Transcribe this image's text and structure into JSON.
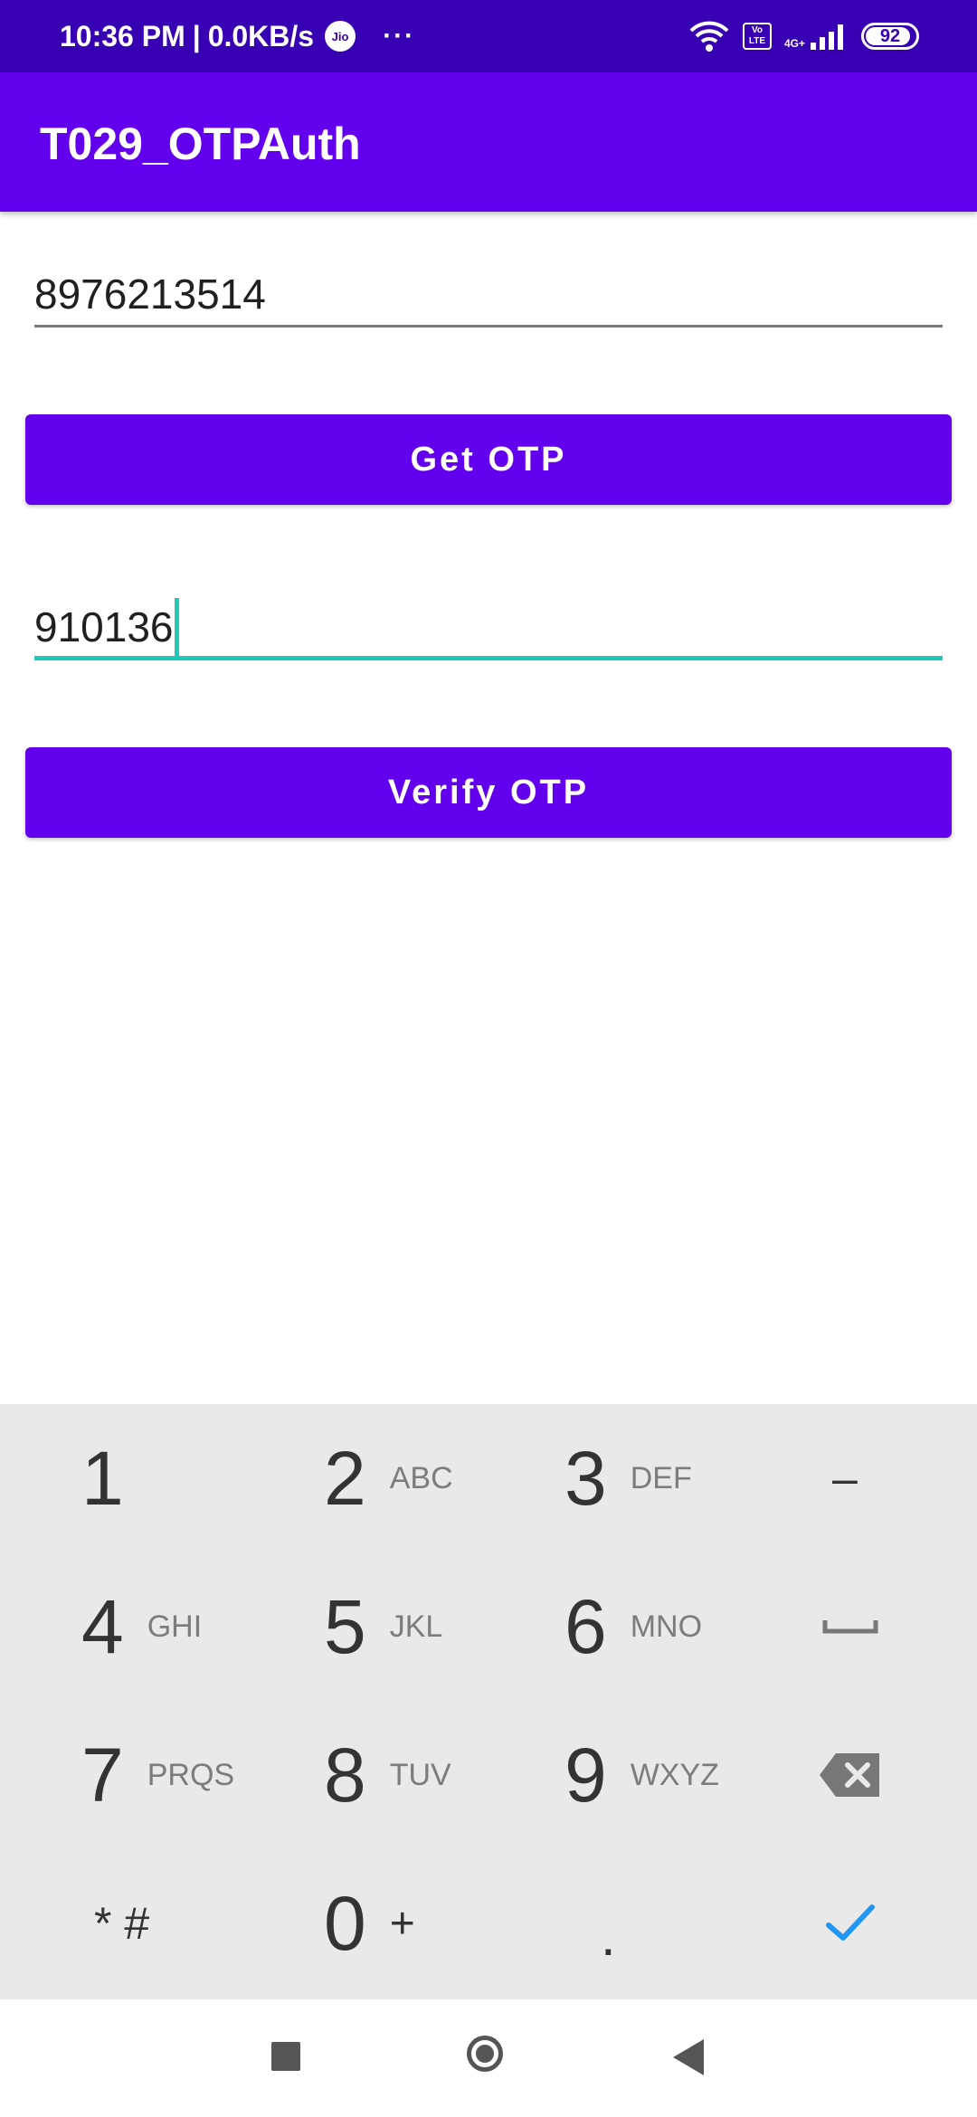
{
  "status_bar": {
    "time": "10:36 PM",
    "speed": "0.0KB/s",
    "carrier": "Jio",
    "volte_line1": "Vo",
    "volte_line2": "LTE",
    "network": "4G+",
    "battery": "92",
    "battery_level": 0.92
  },
  "app_bar": {
    "title": "T029_OTPAuth"
  },
  "form": {
    "phone_value": "8976213514",
    "get_otp_label": "Get OTP",
    "otp_value": "910136",
    "verify_otp_label": "Verify OTP"
  },
  "keyboard": {
    "keys": [
      {
        "main": "1",
        "sub": ""
      },
      {
        "main": "2",
        "sub": "ABC"
      },
      {
        "main": "3",
        "sub": "DEF"
      },
      {
        "main": "–",
        "sub": ""
      },
      {
        "main": "4",
        "sub": "GHI"
      },
      {
        "main": "5",
        "sub": "JKL"
      },
      {
        "main": "6",
        "sub": "MNO"
      },
      {
        "main": "7",
        "sub": "PRQS"
      },
      {
        "main": "8",
        "sub": "TUV"
      },
      {
        "main": "9",
        "sub": "WXYZ"
      },
      {
        "main": "* #",
        "sub": ""
      },
      {
        "main": "0",
        "sub": "+"
      },
      {
        "main": ".",
        "sub": ""
      }
    ],
    "icons": [
      "space-icon",
      "backspace-icon",
      "checkmark-icon"
    ],
    "accent_color": "#2196f3"
  },
  "colors": {
    "status_bar": "#3700b3",
    "primary": "#6200ee",
    "focus_underline": "#1ec9b8"
  }
}
